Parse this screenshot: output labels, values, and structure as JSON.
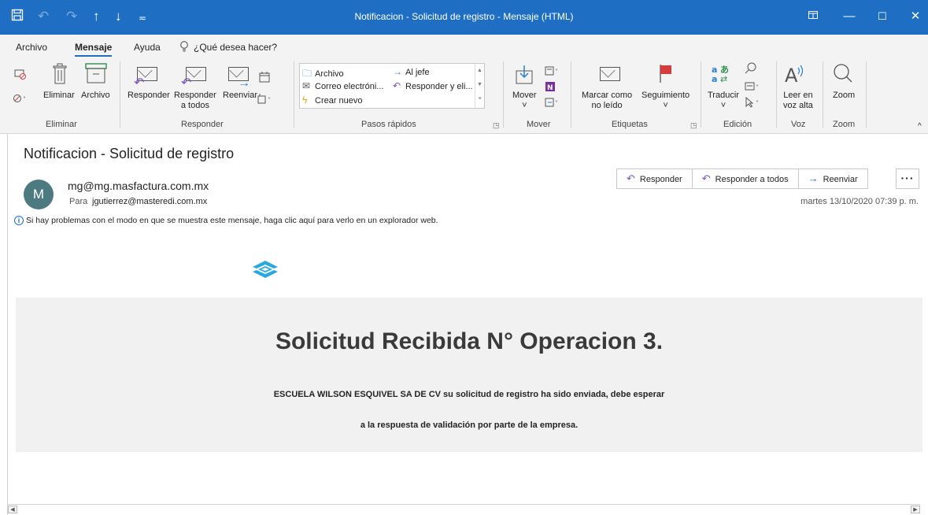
{
  "window": {
    "title": "Notificacion - Solicitud de registro  -  Mensaje (HTML)",
    "qa_icons": [
      "save-icon",
      "undo-icon",
      "redo-icon",
      "up-arrow-icon",
      "down-arrow-icon",
      "customize-icon"
    ]
  },
  "menu": {
    "tabs": [
      "Archivo",
      "Mensaje",
      "Ayuda"
    ],
    "active_tab": "Mensaje",
    "search_placeholder": "¿Qué desea hacer?"
  },
  "ribbon": {
    "groups": {
      "eliminar": {
        "label": "Eliminar",
        "delete": "Eliminar",
        "archive": "Archivo"
      },
      "responder": {
        "label": "Responder",
        "reply": "Responder",
        "reply_all_1": "Responder",
        "reply_all_2": "a todos",
        "forward": "Reenviar"
      },
      "quicksteps": {
        "label": "Pasos rápidos",
        "items": [
          "Archivo",
          "Al jefe",
          "Correo electróni...",
          "Responder y eli...",
          "Crear nuevo"
        ]
      },
      "mover": {
        "label": "Mover",
        "move": "Mover"
      },
      "etiquetas": {
        "label": "Etiquetas",
        "mark_1": "Marcar como",
        "mark_2": "no leído",
        "followup": "Seguimiento"
      },
      "edicion": {
        "label": "Edición",
        "translate": "Traducir"
      },
      "voz": {
        "label": "Voz",
        "read_1": "Leer en",
        "read_2": "voz alta"
      },
      "zoom": {
        "label": "Zoom",
        "zoom": "Zoom"
      }
    }
  },
  "message": {
    "subject": "Notificacion - Solicitud de registro",
    "avatar_initial": "M",
    "sender": "mg@mg.masfactura.com.mx",
    "to_label": "Para",
    "to": "jgutierrez@masteredi.com.mx",
    "info": "Si hay problemas con el modo en que se muestra este mensaje, haga clic aquí para verlo en un explorador web.",
    "actions": {
      "reply": "Responder",
      "reply_all": "Responder a todos",
      "forward": "Reenviar"
    },
    "date": "martes 13/10/2020 07:39 p. m."
  },
  "body": {
    "title": "Solicitud Recibida N° Operacion 3.",
    "line1": "ESCUELA WILSON ESQUIVEL SA DE CV su solicitud de registro ha sido enviada, debe esperar",
    "line2": "a la respuesta de validación por parte de la empresa."
  },
  "colors": {
    "titlebar": "#1e6fc4",
    "ribbon_bg": "#f3f3f3",
    "avatar": "#4d7a80",
    "content_band": "#f1f1f1",
    "logo": "#29a8e0"
  }
}
